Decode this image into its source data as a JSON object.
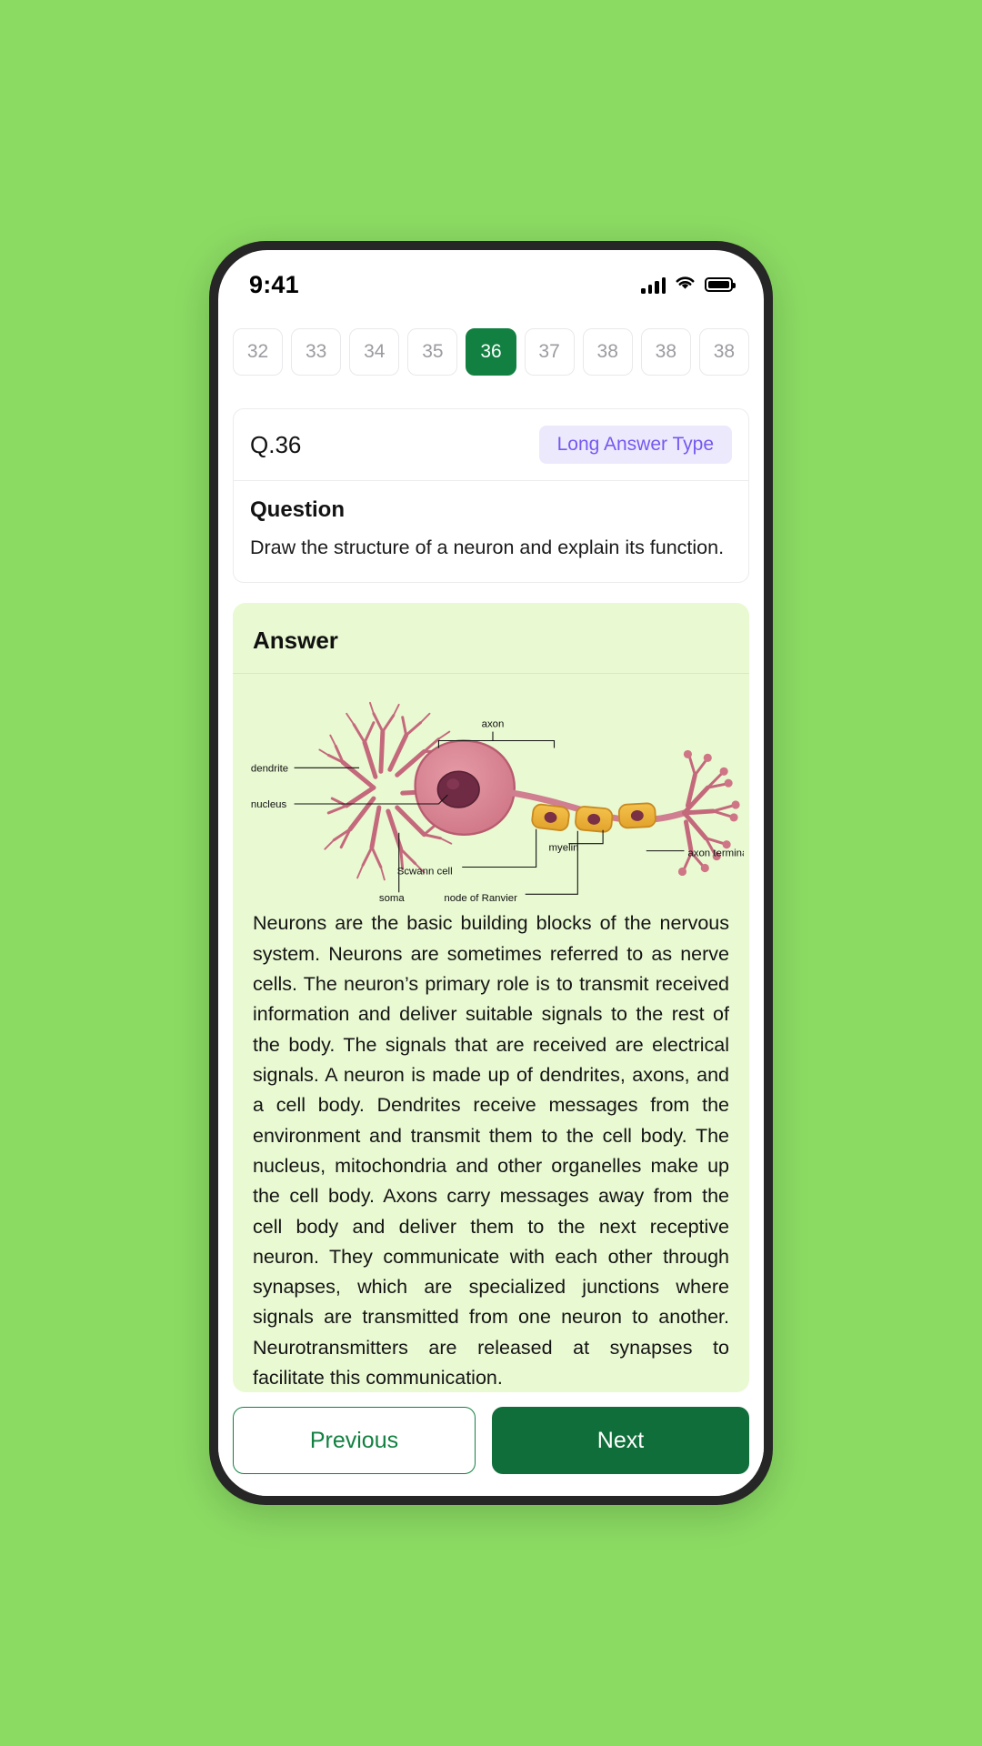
{
  "theme": {
    "page_background": "#8BDB63",
    "accent_green": "#128041",
    "next_button_green": "#0F6E39",
    "answer_card_background": "#E9F9D2",
    "badge_background": "#ECE9FD",
    "badge_text": "#7659F0"
  },
  "status_bar": {
    "time": "9:41",
    "icons": [
      "cellular-signal-icon",
      "wifi-icon",
      "battery-icon"
    ]
  },
  "question_strip": {
    "items": [
      {
        "label": "32",
        "active": false
      },
      {
        "label": "33",
        "active": false
      },
      {
        "label": "34",
        "active": false
      },
      {
        "label": "35",
        "active": false
      },
      {
        "label": "36",
        "active": true
      },
      {
        "label": "37",
        "active": false
      },
      {
        "label": "38",
        "active": false
      },
      {
        "label": "38",
        "active": false
      },
      {
        "label": "38",
        "active": false
      }
    ]
  },
  "question_card": {
    "number": "Q.36",
    "type_badge": "Long Answer Type",
    "section_label": "Question",
    "text": "Draw the structure of a neuron and explain its function."
  },
  "answer_card": {
    "title": "Answer",
    "diagram": {
      "name": "neuron-structure-diagram",
      "labels": [
        "dendrite",
        "nucleus",
        "axon",
        "Scwann cell",
        "myelin",
        "node of Ranvier",
        "axon terminal",
        "soma"
      ]
    },
    "text": "Neurons are the basic building blocks of the nervous system. Neurons are sometimes referred to as nerve cells. The neuron’s primary role is to transmit received information and deliver suitable signals to the rest of the body. The signals that are received are electrical signals. A neuron is made up of dendrites, axons, and a cell body. Dendrites receive messages from the environment and transmit them to the cell body. The nucleus, mitochondria and other organelles make up the cell body. Axons carry messages away from the cell body and deliver them to the next receptive neuron. They communicate with each other through synapses, which are specialized junctions where signals are transmitted from one neuron to another. Neurotransmitters are released at synapses to facilitate this communication."
  },
  "bottom_nav": {
    "previous_label": "Previous",
    "next_label": "Next"
  }
}
